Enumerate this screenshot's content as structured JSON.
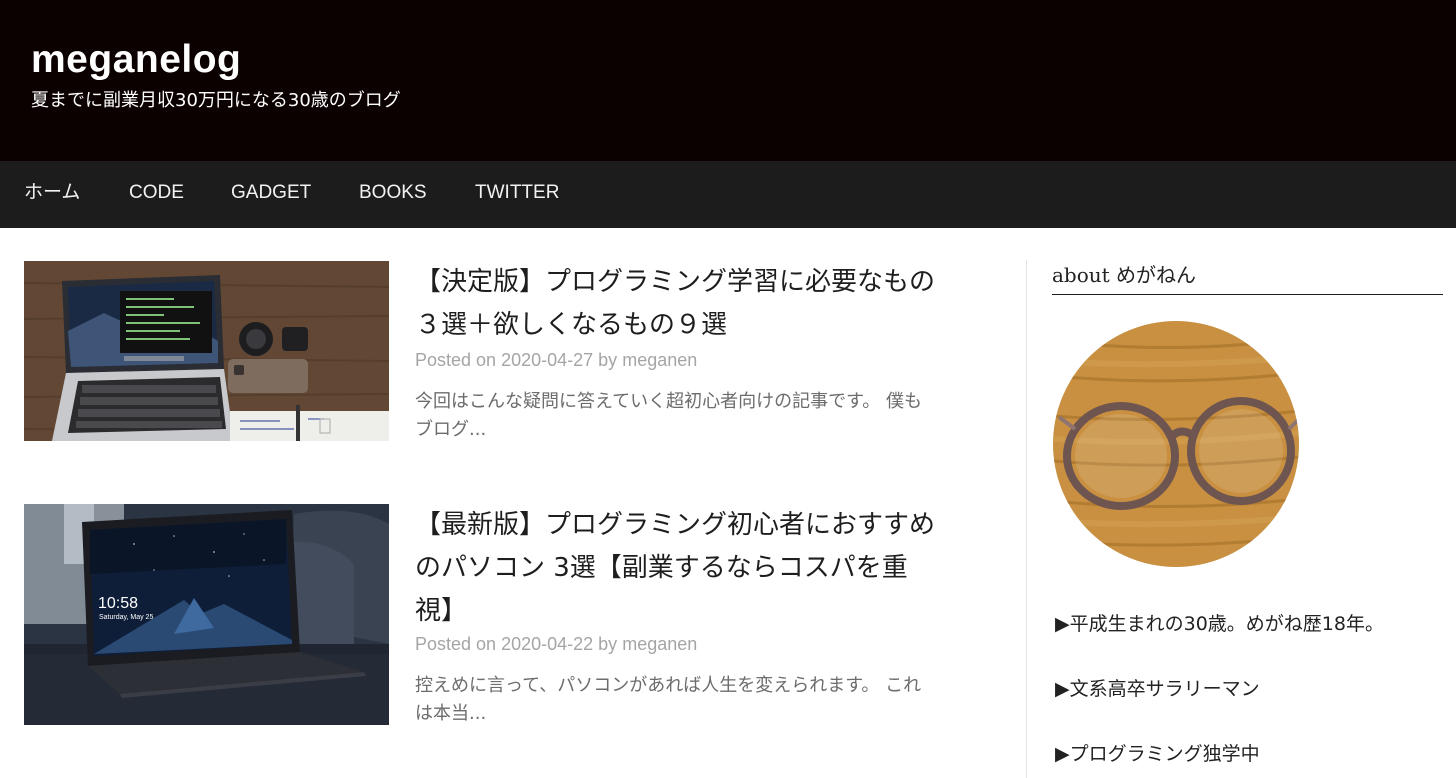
{
  "site": {
    "title": "meganelog",
    "description": "夏までに副業月収30万円になる30歳のブログ"
  },
  "nav": [
    "ホーム",
    "CODE",
    "GADGET",
    "BOOKS",
    "TWITTER"
  ],
  "posts": [
    {
      "title": "【決定版】プログラミング学習に必要なもの３選＋欲しくなるもの９選",
      "posted_on": "Posted on",
      "date": "2020-04-27",
      "by": "by",
      "author": "meganen",
      "excerpt": "今回はこんな疑問に答えていく超初心者向けの記事です。 僕もブログ..."
    },
    {
      "title": "【最新版】プログラミング初心者におすすめのパソコン 3選【副業するならコスパを重視】",
      "posted_on": "Posted on",
      "date": "2020-04-22",
      "by": "by",
      "author": "meganen",
      "excerpt": "控えめに言って、パソコンがあれば人生を変えられます。 これは本当...",
      "thumb_screen": {
        "time": "10:58",
        "date": "Saturday, May 25"
      }
    }
  ],
  "sidebar": {
    "widget_title": "about めがねん",
    "bio": [
      "▶︎平成生まれの30歳。めがね歴18年。",
      "▶︎文系高卒サラリーマン",
      "▶︎プログラミング独学中"
    ]
  },
  "colors": {
    "header_bg": "#0b0101",
    "nav_bg": "#1c1c1c",
    "meta_gray": "#a5a5a5"
  }
}
